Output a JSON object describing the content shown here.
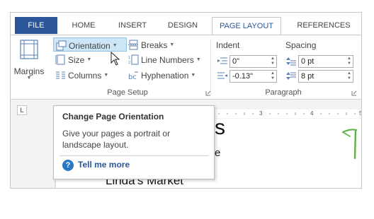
{
  "tabs": [
    {
      "label": "FILE"
    },
    {
      "label": "HOME"
    },
    {
      "label": "INSERT"
    },
    {
      "label": "DESIGN"
    },
    {
      "label": "PAGE LAYOUT"
    },
    {
      "label": "REFERENCES"
    }
  ],
  "page_setup": {
    "margins_label": "Margins",
    "orientation_label": "Orientation",
    "size_label": "Size",
    "columns_label": "Columns",
    "breaks_label": "Breaks",
    "line_numbers_label": "Line Numbers",
    "hyphenation_label": "Hyphenation",
    "group_label": "Page Setup"
  },
  "paragraph": {
    "indent_label": "Indent",
    "spacing_label": "Spacing",
    "indent_left": "0\"",
    "indent_right": "-0.13\"",
    "spacing_before": "0 pt",
    "spacing_after": "8 pt",
    "group_label": "Paragraph"
  },
  "ruler": {
    "tab_marker": "L",
    "tick_3": "3",
    "tick_4": "4",
    "tick_5": "5"
  },
  "tooltip": {
    "title": "Change Page Orientation",
    "body": "Give your pages a portrait or landscape layout.",
    "link": "Tell me more",
    "help_glyph": "?"
  },
  "document": {
    "frag_s": "s",
    "frag_e": "e",
    "frag_heading": "Linda's Market"
  },
  "colors": {
    "accent": "#2b579a",
    "highlight": "#cde6f7",
    "ruler_band": "#f3f3f3",
    "green_deco": "#5fb346"
  }
}
